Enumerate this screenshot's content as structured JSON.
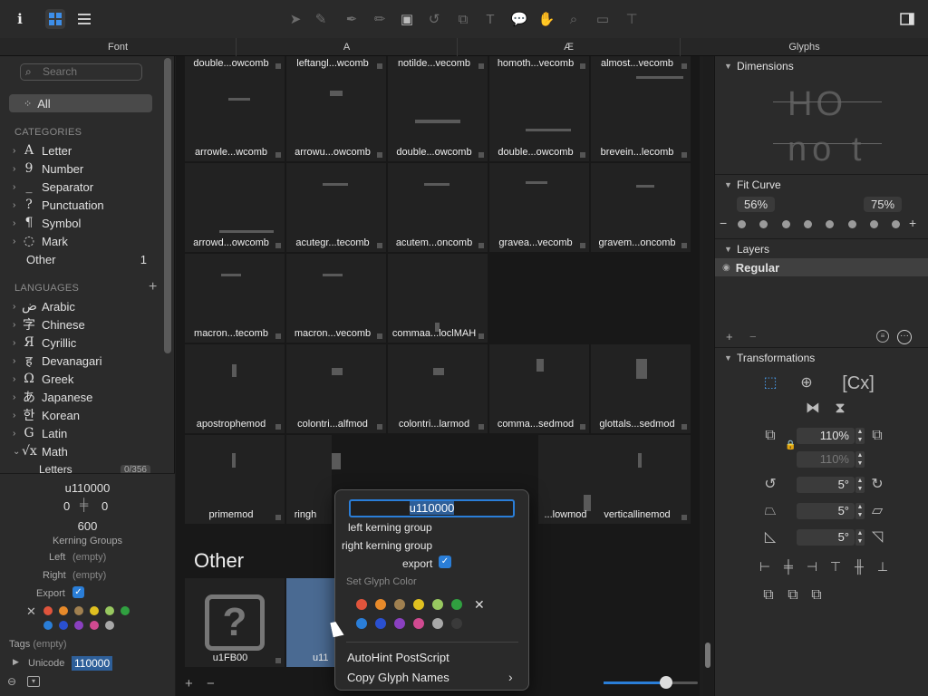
{
  "toolbar": {
    "info": "i",
    "grid_view": "grid",
    "list_view": "list"
  },
  "tabs": [
    "Font",
    "A",
    "Æ",
    "Glyphs"
  ],
  "sidebar": {
    "search_placeholder": "Search",
    "all": "All",
    "categories_title": "CATEGORIES",
    "categories": [
      {
        "glyph": "A",
        "label": "Letter"
      },
      {
        "glyph": "9",
        "label": "Number"
      },
      {
        "glyph": "_",
        "label": "Separator"
      },
      {
        "glyph": "?",
        "label": "Punctuation"
      },
      {
        "glyph": "¶",
        "label": "Symbol"
      },
      {
        "glyph": "◌",
        "label": "Mark"
      }
    ],
    "other_label": "Other",
    "other_count": "1",
    "languages_title": "LANGUAGES",
    "languages": [
      {
        "glyph": "ض",
        "label": "Arabic"
      },
      {
        "glyph": "字",
        "label": "Chinese"
      },
      {
        "glyph": "Я",
        "label": "Cyrillic"
      },
      {
        "glyph": "ह",
        "label": "Devanagari"
      },
      {
        "glyph": "Ω",
        "label": "Greek"
      },
      {
        "glyph": "あ",
        "label": "Japanese"
      },
      {
        "glyph": "한",
        "label": "Korean"
      },
      {
        "glyph": "G",
        "label": "Latin"
      },
      {
        "glyph": "√x",
        "label": "Math"
      }
    ],
    "letters_label": "Letters",
    "letters_count": "0/356"
  },
  "info": {
    "name": "u110000",
    "lsb": "0",
    "rsb": "0",
    "width": "600",
    "kerning_title": "Kerning Groups",
    "left_label": "Left",
    "left_value": "(empty)",
    "right_label": "Right",
    "right_value": "(empty)",
    "export_label": "Export",
    "tags_label": "Tags",
    "tags_value": "(empty)",
    "unicode_label": "Unicode",
    "unicode_value": "110000"
  },
  "colors": {
    "swatches": [
      "#e0543c",
      "#e88a2a",
      "#a08050",
      "#e0c020",
      "#98c860",
      "#30a040",
      "#2a7ed8",
      "#2a50d0",
      "#8a40c0",
      "#d04a90",
      "#a8a8a8",
      "#3a3a3a"
    ]
  },
  "glyphs": [
    [
      "double...owcomb",
      "leftangl...wcomb",
      "notilde...vecomb",
      "homoth...vecomb",
      "almost...vecomb"
    ],
    [
      "arrowle...wcomb",
      "arrowu...owcomb",
      "double...owcomb",
      "double...owcomb",
      "brevein...lecomb"
    ],
    [
      "arrowd...owcomb",
      "acutegr...tecomb",
      "acutem...oncomb",
      "gravea...vecomb",
      "gravem...oncomb"
    ],
    [
      "macron...tecomb",
      "macron...vecomb",
      "commaa...loclMAH"
    ],
    [
      "apostrophemod",
      "colontri...alfmod",
      "colontri...larmod",
      "comma...sedmod",
      "glottals...sedmod"
    ],
    [
      "primemod",
      "ringh",
      "",
      "...lowmod",
      "verticallinemod"
    ]
  ],
  "other_section": {
    "title": "Other",
    "glyphs": [
      "u1FB00",
      "u11"
    ]
  },
  "menu": {
    "name_value": "u110000",
    "left_kerning": "left kerning group",
    "right_kerning": "right kerning group",
    "export": "export",
    "color_title": "Set Glyph Color",
    "autohint": "AutoHint PostScript",
    "copy_names": "Copy Glyph Names"
  },
  "panel": {
    "dimensions": "Dimensions",
    "preview_top": "HO",
    "preview_bottom": "no t",
    "fit_curve": "Fit Curve",
    "fit_left": "56%",
    "fit_right": "75%",
    "layers": "Layers",
    "layer_name": "Regular",
    "transformations": "Transformations",
    "scale_x": "110%",
    "scale_y": "110%",
    "rotate": "5°",
    "slant": "5°",
    "skew": "5°"
  }
}
